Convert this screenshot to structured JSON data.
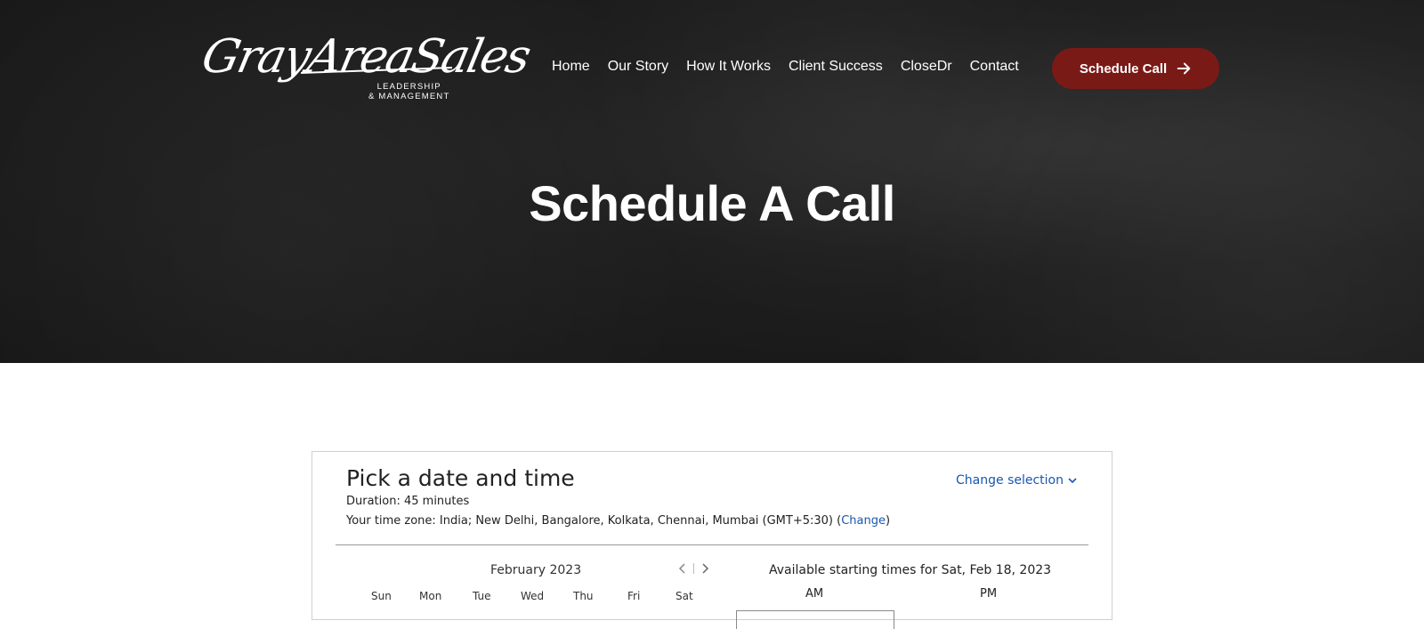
{
  "header": {
    "logo": {
      "script": "GrayAreaSales",
      "line1": "LEADERSHIP",
      "line2": "& MANAGEMENT"
    },
    "nav": [
      "Home",
      "Our Story",
      "How It Works",
      "Client Success",
      "CloseDr",
      "Contact"
    ],
    "cta_label": "Schedule Call"
  },
  "hero": {
    "title": "Schedule A Call"
  },
  "scheduler": {
    "title": "Pick a date and time",
    "duration": "Duration: 45 minutes",
    "timezone_prefix": "Your time zone: India;  New Delhi, Bangalore, Kolkata, Chennai, Mumbai  (GMT+5:30)  (",
    "timezone_change": "Change",
    "timezone_suffix": ")",
    "change_selection": "Change selection",
    "month": "February 2023",
    "weekdays": [
      "Sun",
      "Mon",
      "Tue",
      "Wed",
      "Thu",
      "Fri",
      "Sat"
    ],
    "available_label": "Available starting times for Sat, Feb 18, 2023",
    "am_label": "AM",
    "pm_label": "PM"
  },
  "colors": {
    "cta": "#7a1a16",
    "link": "#1a56b0"
  }
}
